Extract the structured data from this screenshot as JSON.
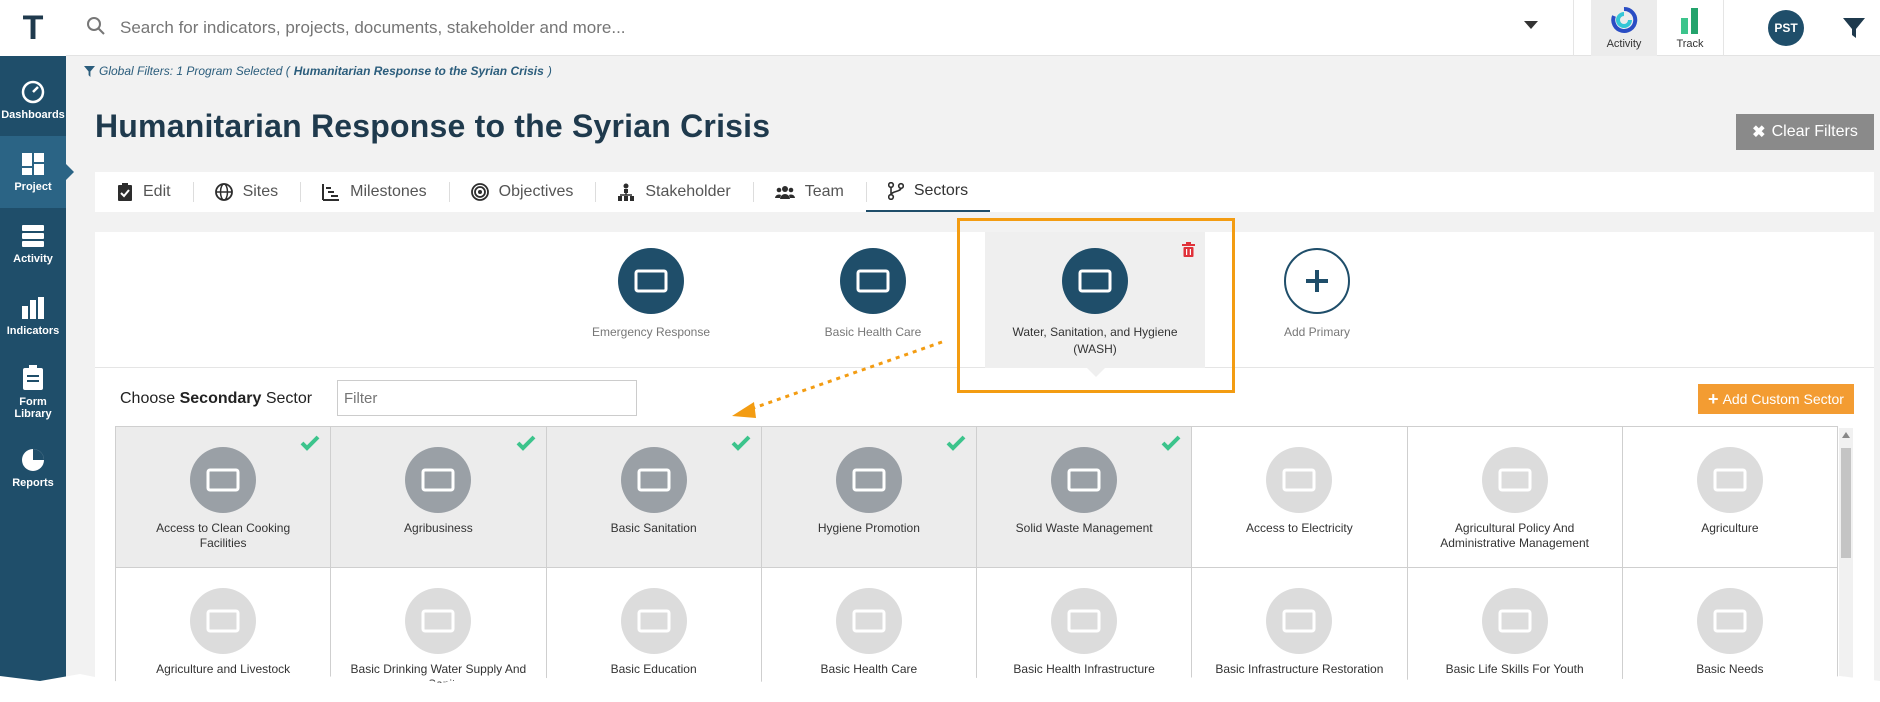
{
  "app": {
    "logo": "T"
  },
  "search": {
    "placeholder": "Search for indicators, projects, documents, stakeholder and more..."
  },
  "top_actions": [
    {
      "label": "Activity",
      "icon": "activity-icon"
    },
    {
      "label": "Track",
      "icon": "track-icon"
    }
  ],
  "user": {
    "initials": "PST"
  },
  "sidebar": {
    "items": [
      {
        "label": "Dashboards",
        "icon": "dashboard-icon"
      },
      {
        "label": "Project",
        "icon": "project-icon"
      },
      {
        "label": "Activity",
        "icon": "activity-list-icon"
      },
      {
        "label": "Indicators",
        "icon": "indicators-icon"
      },
      {
        "label": "Form Library",
        "icon": "form-library-icon"
      },
      {
        "label": "Reports",
        "icon": "reports-icon"
      }
    ]
  },
  "global_filters": {
    "prefix": "Global Filters: 1 Program Selected (",
    "program": "Humanitarian Response to the Syrian Crisis",
    "suffix": ")"
  },
  "page": {
    "title": "Humanitarian Response to the Syrian Crisis",
    "clear_filters": "Clear Filters"
  },
  "tabs": [
    {
      "label": "Edit",
      "icon": "clipboard-icon"
    },
    {
      "label": "Sites",
      "icon": "globe-icon"
    },
    {
      "label": "Milestones",
      "icon": "milestones-icon"
    },
    {
      "label": "Objectives",
      "icon": "target-icon"
    },
    {
      "label": "Stakeholder",
      "icon": "hierarchy-icon"
    },
    {
      "label": "Team",
      "icon": "team-icon"
    },
    {
      "label": "Sectors",
      "icon": "branch-icon"
    }
  ],
  "primary_sectors": [
    {
      "label": "Emergency Response"
    },
    {
      "label": "Basic Health Care"
    },
    {
      "label": "Water, Sanitation, and Hygiene (WASH)"
    },
    {
      "label": "Add Primary"
    }
  ],
  "secondary": {
    "label_prefix": "Choose ",
    "label_bold": "Secondary",
    "label_suffix": " Sector",
    "filter_placeholder": "Filter",
    "add_custom": "Add Custom Sector"
  },
  "secondary_sectors": [
    {
      "label": "Access to Clean Cooking Facilities",
      "selected": true
    },
    {
      "label": "Agribusiness",
      "selected": true
    },
    {
      "label": "Basic Sanitation",
      "selected": true
    },
    {
      "label": "Hygiene Promotion",
      "selected": true
    },
    {
      "label": "Solid Waste Management",
      "selected": true
    },
    {
      "label": "Access to Electricity",
      "selected": false
    },
    {
      "label": "Agricultural Policy And Administrative Management",
      "selected": false
    },
    {
      "label": "Agriculture",
      "selected": false
    },
    {
      "label": "Agriculture and Livestock",
      "selected": false
    },
    {
      "label": "Basic Drinking Water Supply And Basic Sanitation",
      "selected": false
    },
    {
      "label": "Basic Education",
      "selected": false
    },
    {
      "label": "Basic Health Care",
      "selected": false
    },
    {
      "label": "Basic Health Infrastructure",
      "selected": false
    },
    {
      "label": "Basic Infrastructure Restoration",
      "selected": false
    },
    {
      "label": "Basic Life Skills For Youth",
      "selected": false
    },
    {
      "label": "Basic Needs",
      "selected": false
    }
  ],
  "colors": {
    "navy": "#1f4e6a",
    "accent": "#f39c12",
    "check": "#3cc48c",
    "trash": "#e0323a"
  }
}
